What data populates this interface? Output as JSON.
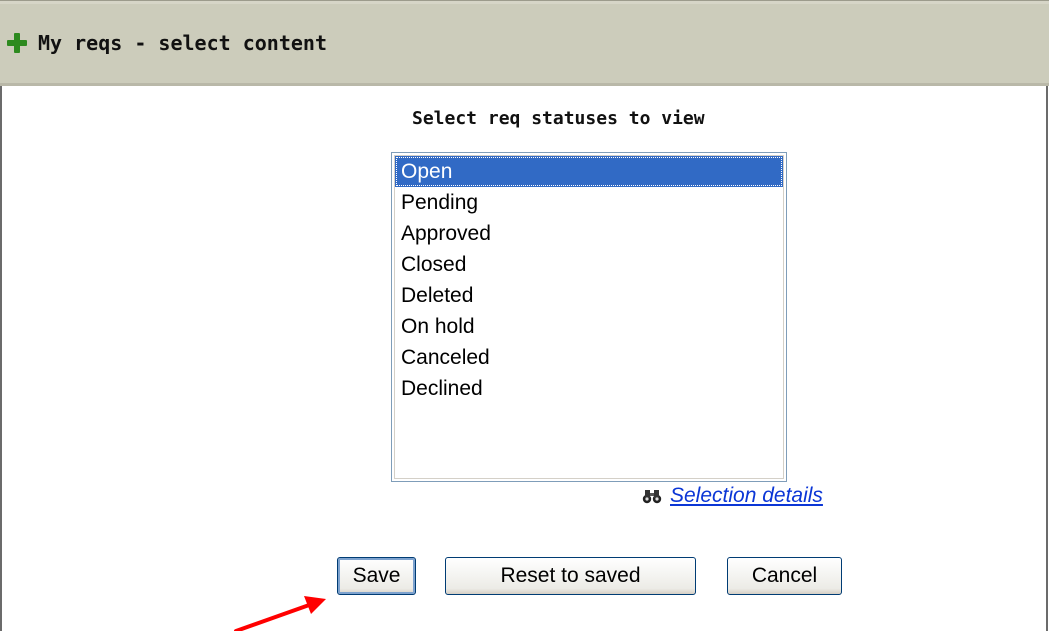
{
  "header": {
    "title": "My reqs - select content",
    "icon": "plus-icon"
  },
  "prompt": "Select req statuses to view",
  "statuses": {
    "items": [
      "Open",
      "Pending",
      "Approved",
      "Closed",
      "Deleted",
      "On hold",
      "Canceled",
      "Declined"
    ],
    "selected": "Open"
  },
  "details_link": {
    "label": "Selection details",
    "icon": "binoculars-icon"
  },
  "buttons": {
    "save": "Save",
    "reset": "Reset to saved",
    "cancel": "Cancel"
  },
  "colors": {
    "title_bg": "#ccccbb",
    "selection": "#316ac5",
    "link": "#0b36d6",
    "annotation_arrow": "#ff0000",
    "plus": "#2d8a1f"
  }
}
